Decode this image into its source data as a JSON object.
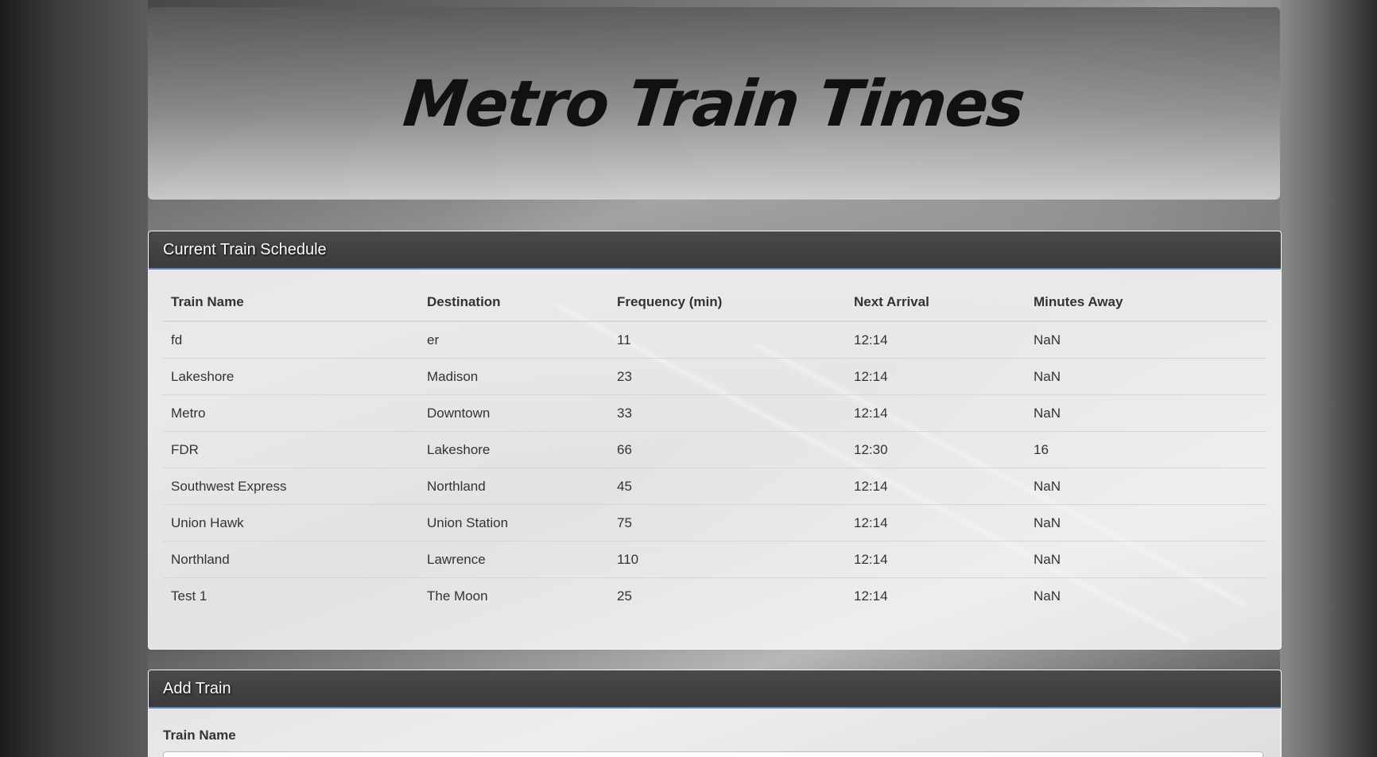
{
  "header": {
    "title": "Metro Train Times"
  },
  "schedule": {
    "heading": "Current Train Schedule",
    "columns": [
      "Train Name",
      "Destination",
      "Frequency (min)",
      "Next Arrival",
      "Minutes Away"
    ],
    "rows": [
      [
        "fd",
        "er",
        "11",
        "12:14",
        "NaN"
      ],
      [
        "Lakeshore",
        "Madison",
        "23",
        "12:14",
        "NaN"
      ],
      [
        "Metro",
        "Downtown",
        "33",
        "12:14",
        "NaN"
      ],
      [
        "FDR",
        "Lakeshore",
        "66",
        "12:30",
        "16"
      ],
      [
        "Southwest Express",
        "Northland",
        "45",
        "12:14",
        "NaN"
      ],
      [
        "Union Hawk",
        "Union Station",
        "75",
        "12:14",
        "NaN"
      ],
      [
        "Northland",
        "Lawrence",
        "110",
        "12:14",
        "NaN"
      ],
      [
        "Test 1",
        "The Moon",
        "25",
        "12:14",
        "NaN"
      ]
    ]
  },
  "add_train": {
    "heading": "Add Train",
    "train_name_label": "Train Name",
    "train_name_value": ""
  },
  "colors": {
    "panel_heading_bg": "#3a3a3a",
    "panel_heading_border": "#5f86b8"
  }
}
